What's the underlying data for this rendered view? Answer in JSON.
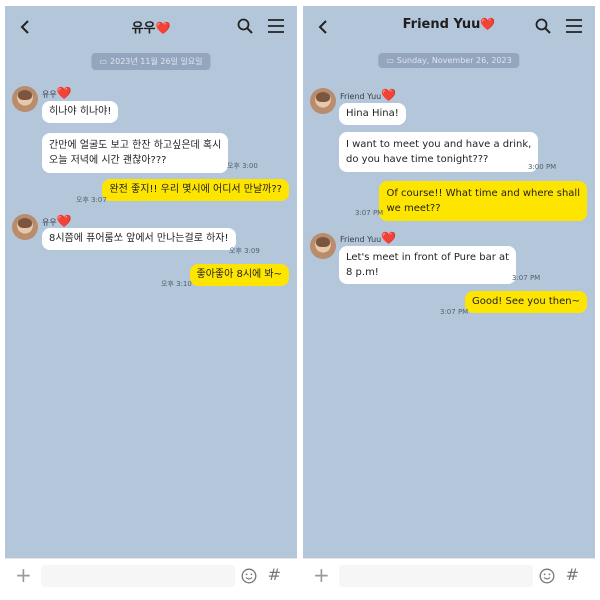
{
  "korean": {
    "title": "유우",
    "heart": "❤️",
    "date": "2023년 11월 26일 일요일",
    "sender": "유우",
    "messages": [
      "히나야 히나야!",
      "간만에 얼굴도 보고 한잔 하고싶은데 혹시",
      "오늘 저녁에 시간 괜찮아???",
      "완전 좋지!! 우리 몇시에 어디서 만날까??",
      "8시쯤에 퓨어룸쏘 앞에서 만나는걸로 하자!",
      "좋아좋아 8시에 봐~"
    ],
    "times": [
      "오후 3:00",
      "오후 3:07",
      "오후 3:09",
      "오후 3:10"
    ]
  },
  "english": {
    "title": "Friend Yuu",
    "heart": "❤️",
    "date": "Sunday, November 26, 2023",
    "sender": "Friend Yuu",
    "messages": [
      "Hina Hina!",
      "I want to meet you and have a drink,",
      "do you have time tonight???",
      "Of course!! What time and where shall",
      "we meet??",
      "Let's meet in front of Pure bar at",
      "8 p.m!",
      "Good! See you then~"
    ],
    "times": [
      "3:00 PM",
      "3:07 PM",
      "3:07 PM",
      "3:07 PM"
    ]
  },
  "icons": {
    "back": "chevron-left-icon",
    "search": "search-icon",
    "menu": "menu-icon",
    "add": "plus-icon",
    "emoji": "smile-icon",
    "hash": "hash-icon"
  },
  "colors": {
    "chat_background": "#b4c6d9",
    "my_bubble": "#fee500",
    "their_bubble": "#ffffff"
  },
  "input": {
    "add_glyph": "+",
    "hash_glyph": "#"
  }
}
